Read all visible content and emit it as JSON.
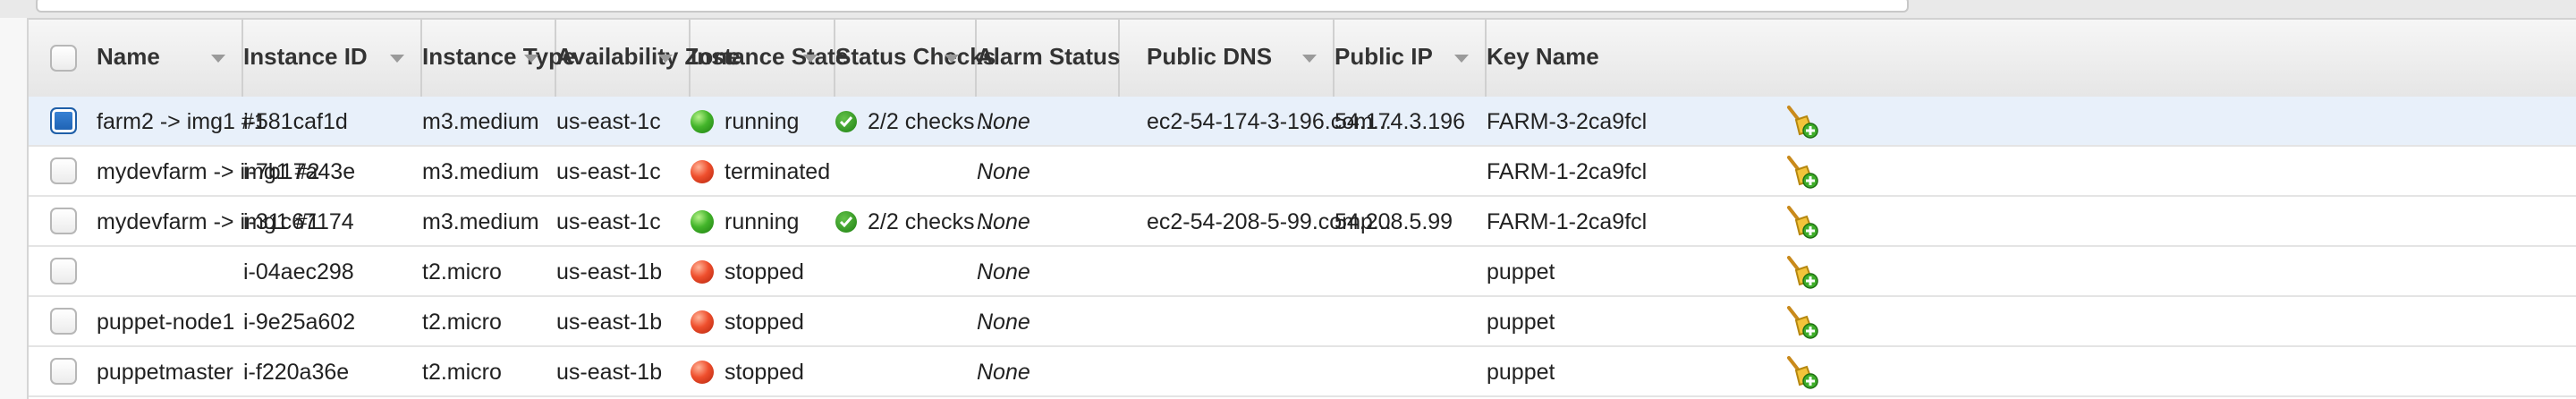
{
  "table": {
    "columns": [
      {
        "key": "name",
        "label": "Name",
        "sortable": true
      },
      {
        "key": "instance_id",
        "label": "Instance ID",
        "sortable": true
      },
      {
        "key": "instance_type",
        "label": "Instance Type",
        "sortable": true
      },
      {
        "key": "availability_zone",
        "label": "Availability Zone",
        "sortable": true
      },
      {
        "key": "instance_state",
        "label": "Instance State",
        "sortable": true
      },
      {
        "key": "status_checks",
        "label": "Status Checks",
        "sortable": true
      },
      {
        "key": "alarm_status",
        "label": "Alarm Status",
        "sortable": false
      },
      {
        "key": "public_dns",
        "label": "Public DNS",
        "sortable": true
      },
      {
        "key": "public_ip",
        "label": "Public IP",
        "sortable": true
      },
      {
        "key": "key_name",
        "label": "Key Name",
        "sortable": false
      }
    ],
    "rows": [
      {
        "selected": true,
        "name": "farm2 -> img1 #1",
        "instance_id": "i-581caf1d",
        "instance_type": "m3.medium",
        "availability_zone": "us-east-1c",
        "state": "running",
        "state_color": "green",
        "status_checks": "2/2 checks ...",
        "alarm": "None",
        "public_dns": "ec2-54-174-3-196.com...",
        "public_ip": "54.174.3.196",
        "key_name": "FARM-3-2ca9fcl"
      },
      {
        "selected": false,
        "name": "mydevfarm -> img1 #2",
        "instance_id": "i-7b17a43e",
        "instance_type": "m3.medium",
        "availability_zone": "us-east-1c",
        "state": "terminated",
        "state_color": "red",
        "status_checks": "",
        "alarm": "None",
        "public_dns": "",
        "public_ip": "",
        "key_name": "FARM-1-2ca9fcl"
      },
      {
        "selected": false,
        "name": "mydevfarm -> img1 #1",
        "instance_id": "i-31c67174",
        "instance_type": "m3.medium",
        "availability_zone": "us-east-1c",
        "state": "running",
        "state_color": "green",
        "status_checks": "2/2 checks ...",
        "alarm": "None",
        "public_dns": "ec2-54-208-5-99.comp...",
        "public_ip": "54.208.5.99",
        "key_name": "FARM-1-2ca9fcl"
      },
      {
        "selected": false,
        "name": "",
        "instance_id": "i-04aec298",
        "instance_type": "t2.micro",
        "availability_zone": "us-east-1b",
        "state": "stopped",
        "state_color": "red",
        "status_checks": "",
        "alarm": "None",
        "public_dns": "",
        "public_ip": "",
        "key_name": "puppet"
      },
      {
        "selected": false,
        "name": "puppet-node1",
        "instance_id": "i-9e25a602",
        "instance_type": "t2.micro",
        "availability_zone": "us-east-1b",
        "state": "stopped",
        "state_color": "red",
        "status_checks": "",
        "alarm": "None",
        "public_dns": "",
        "public_ip": "",
        "key_name": "puppet"
      },
      {
        "selected": false,
        "name": "puppetmaster",
        "instance_id": "i-f220a36e",
        "instance_type": "t2.micro",
        "availability_zone": "us-east-1b",
        "state": "stopped",
        "state_color": "red",
        "status_checks": "",
        "alarm": "None",
        "public_dns": "",
        "public_ip": "",
        "key_name": "puppet"
      }
    ]
  },
  "icons": {
    "state_running": "green-circle-icon",
    "state_stopped": "red-circle-icon",
    "status_ok": "green-check-icon",
    "create_alarm": "create-alarm-broom-icon"
  },
  "colors": {
    "selected_row": "#e8f0fa",
    "running": "#43b52a",
    "stopped": "#ef4f2d",
    "checkbox_selected": "#1c5fb0"
  }
}
